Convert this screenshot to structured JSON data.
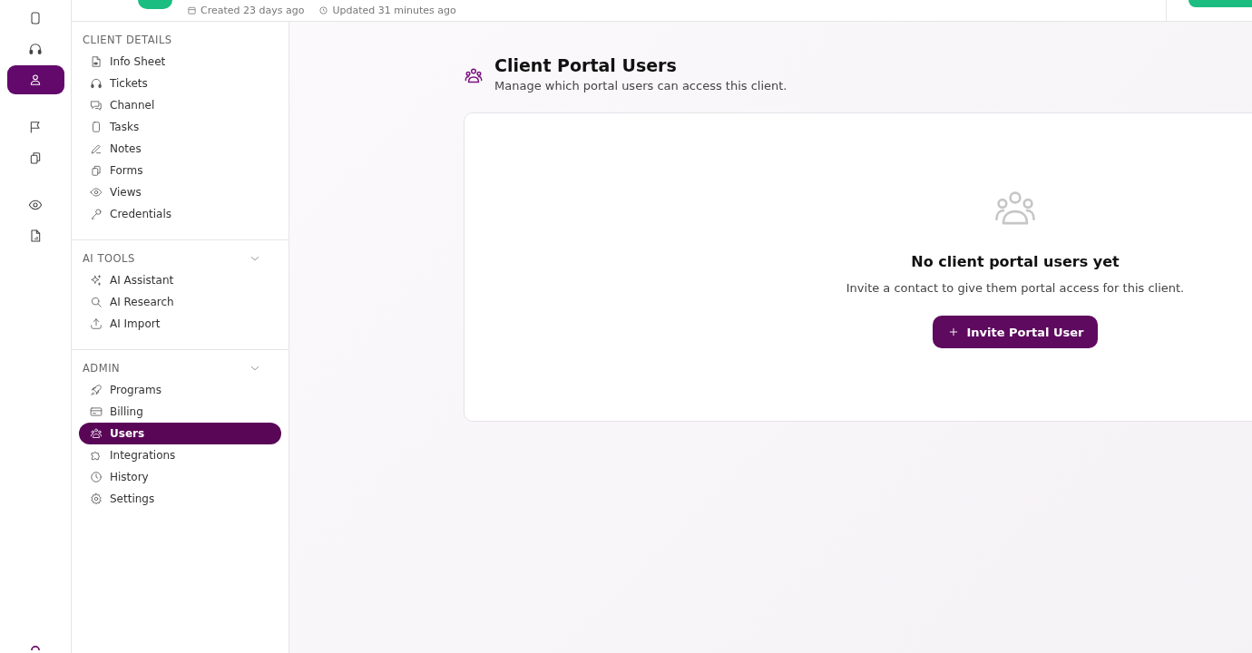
{
  "top_bar": {
    "created": "Created 23 days ago",
    "updated": "Updated 31 minutes ago"
  },
  "rail": [
    {
      "selected": false
    },
    {
      "selected": false
    },
    {
      "selected": true
    },
    {
      "selected": false
    },
    {
      "selected": false
    },
    {
      "selected": false
    },
    {
      "selected": false
    }
  ],
  "sidebar": {
    "sections": [
      {
        "title": "CLIENT DETAILS",
        "chevron": false,
        "items": [
          {
            "label": "Info Sheet",
            "selected": false
          },
          {
            "label": "Tickets",
            "selected": false
          },
          {
            "label": "Channel",
            "selected": false
          },
          {
            "label": "Tasks",
            "selected": false
          },
          {
            "label": "Notes",
            "selected": false
          },
          {
            "label": "Forms",
            "selected": false
          },
          {
            "label": "Views",
            "selected": false
          },
          {
            "label": "Credentials",
            "selected": false
          }
        ]
      },
      {
        "title": "AI TOOLS",
        "chevron": true,
        "items": [
          {
            "label": "AI Assistant",
            "selected": false
          },
          {
            "label": "AI Research",
            "selected": false
          },
          {
            "label": "AI Import",
            "selected": false
          }
        ]
      },
      {
        "title": "ADMIN",
        "chevron": true,
        "items": [
          {
            "label": "Programs",
            "selected": false
          },
          {
            "label": "Billing",
            "selected": false
          },
          {
            "label": "Users",
            "selected": true
          },
          {
            "label": "Integrations",
            "selected": false
          },
          {
            "label": "History",
            "selected": false
          },
          {
            "label": "Settings",
            "selected": false
          }
        ]
      }
    ]
  },
  "page": {
    "title": "Client Portal Users",
    "subtitle": "Manage which portal users can access this client."
  },
  "empty_state": {
    "title": "No client portal users yet",
    "message": "Invite a contact to give them portal access for this client.",
    "button": "Invite Portal User"
  }
}
